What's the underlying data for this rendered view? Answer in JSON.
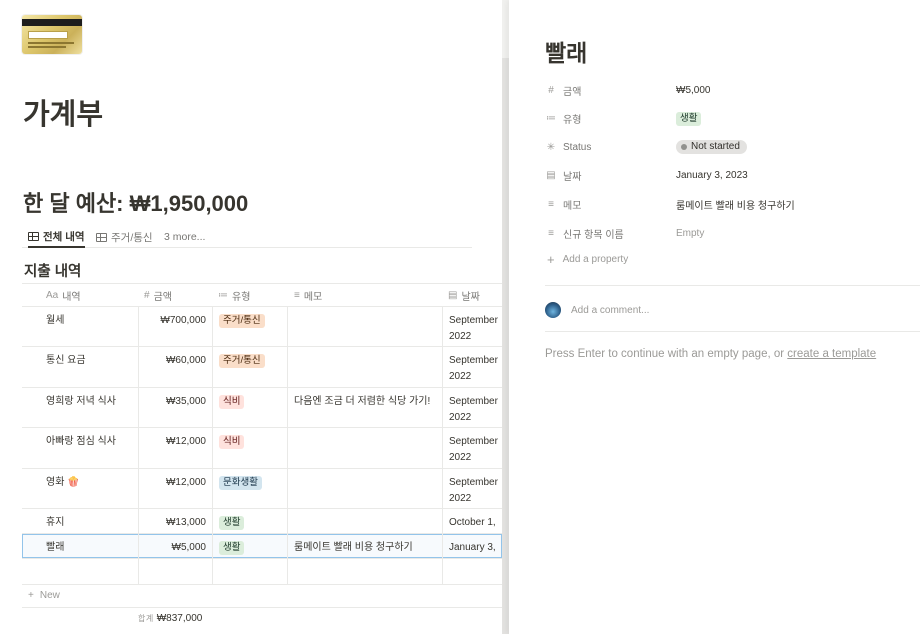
{
  "page": {
    "title": "가계부",
    "budget_heading": "한 달 예산: ₩1,950,000"
  },
  "views": {
    "tabs": [
      {
        "label": "전체 내역",
        "icon": "table-icon"
      },
      {
        "label": "주거/통신",
        "icon": "table-icon"
      },
      {
        "label": "3 more...",
        "icon": ""
      }
    ]
  },
  "database": {
    "title": "지출 내역",
    "columns": [
      {
        "label": "내역",
        "icon": "Aa"
      },
      {
        "label": "금액",
        "icon": "#"
      },
      {
        "label": "유형",
        "icon": "≔"
      },
      {
        "label": "메모",
        "icon": "≡"
      },
      {
        "label": "날짜",
        "icon": "▤"
      }
    ],
    "rows": [
      {
        "name": "월세",
        "amount": "₩700,000",
        "type": "주거/통신",
        "type_color": "orange",
        "memo": "",
        "date1": "September",
        "date2": "2022"
      },
      {
        "name": "통신 요금",
        "amount": "₩60,000",
        "type": "주거/통신",
        "type_color": "orange",
        "memo": "",
        "date1": "September",
        "date2": "2022"
      },
      {
        "name": "영희랑 저녁 식사",
        "amount": "₩35,000",
        "type": "식비",
        "type_color": "red",
        "memo": "다음엔 조금 더 저렴한 식당 가기!",
        "date1": "September",
        "date2": "2022"
      },
      {
        "name": "아빠랑 점심 식사",
        "amount": "₩12,000",
        "type": "식비",
        "type_color": "red",
        "memo": "",
        "date1": "September",
        "date2": "2022"
      },
      {
        "name": "영화 🍿",
        "amount": "₩12,000",
        "type": "문화생활",
        "type_color": "blue",
        "memo": "",
        "date1": "September",
        "date2": "2022"
      },
      {
        "name": "휴지",
        "amount": "₩13,000",
        "type": "생활",
        "type_color": "green",
        "memo": "",
        "date1": "October 1,",
        "date2": ""
      },
      {
        "name": "빨래",
        "amount": "₩5,000",
        "type": "생활",
        "type_color": "green",
        "memo": "룸메이트 빨래 비용 청구하기",
        "date1": "January 3,",
        "date2": ""
      }
    ],
    "new_label": "New",
    "sum_label": "합계",
    "sum_value": "₩837,000"
  },
  "peek": {
    "title": "빨래",
    "properties": [
      {
        "icon": "#",
        "label": "금액",
        "value": "₩5,000",
        "kind": "text"
      },
      {
        "icon": "≔",
        "label": "유형",
        "value": "생활",
        "kind": "tag"
      },
      {
        "icon": "✳",
        "label": "Status",
        "value": "Not started",
        "kind": "status"
      },
      {
        "icon": "▤",
        "label": "날짜",
        "value": "January 3, 2023",
        "kind": "text"
      },
      {
        "icon": "≡",
        "label": "메모",
        "value": "룸메이트 빨래 비용 청구하기",
        "kind": "text"
      },
      {
        "icon": "≡",
        "label": "신규 항목 이름",
        "value": "Empty",
        "kind": "empty"
      }
    ],
    "add_property": "Add a property",
    "comment_placeholder": "Add a comment...",
    "hint_prefix": "Press Enter to continue with an empty page, or ",
    "hint_link": "create a template"
  }
}
